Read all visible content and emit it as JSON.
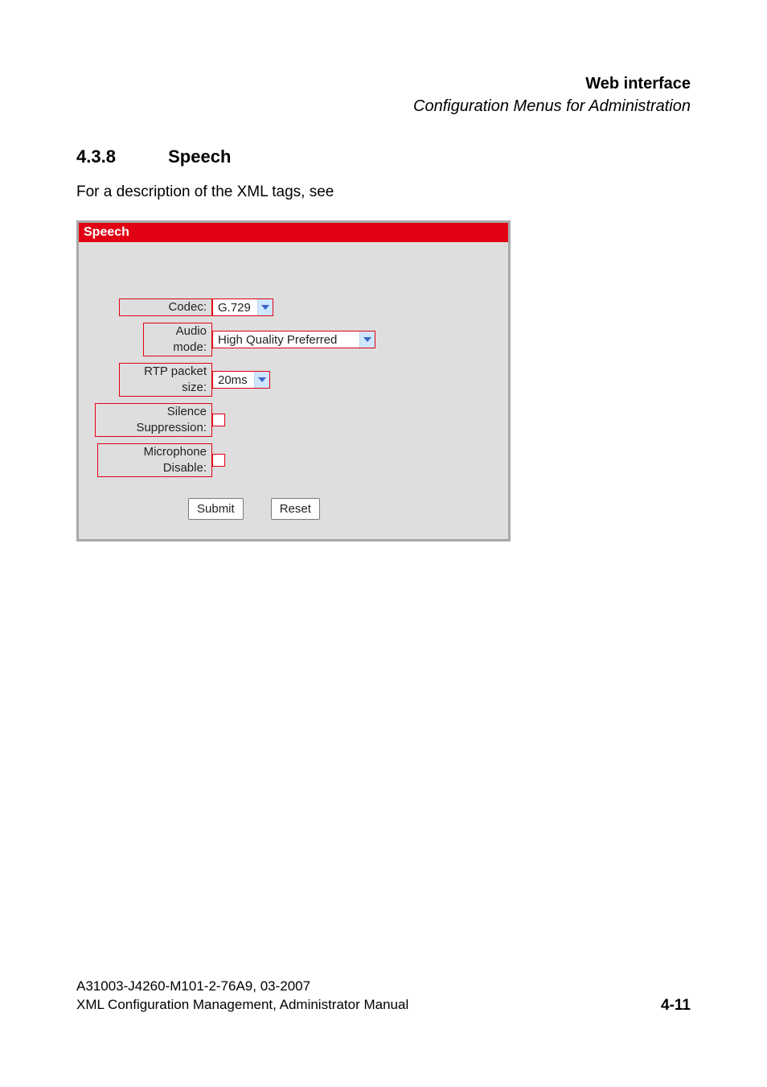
{
  "header": {
    "title": "Web interface",
    "subtitle": "Configuration Menus for Administration"
  },
  "section": {
    "number": "4.3.8",
    "title": "Speech"
  },
  "introText": "For a description of the XML tags, see",
  "panel": {
    "title": "Speech",
    "fields": {
      "codec": {
        "label": "Codec:",
        "value": "G.729"
      },
      "audioMode": {
        "label": "Audio mode:",
        "value": "High Quality Preferred"
      },
      "rtpPacketSize": {
        "label": "RTP packet size:",
        "value": "20ms"
      },
      "silenceSuppression": {
        "label": "Silence Suppression:",
        "checked": false
      },
      "microphoneDisable": {
        "label": "Microphone Disable:",
        "checked": false
      }
    },
    "buttons": {
      "submit": "Submit",
      "reset": "Reset"
    }
  },
  "footer": {
    "line1": "A31003-J4260-M101-2-76A9, 03-2007",
    "line2": "XML Configuration Management, Administrator Manual",
    "pageNumber": "4-11"
  }
}
